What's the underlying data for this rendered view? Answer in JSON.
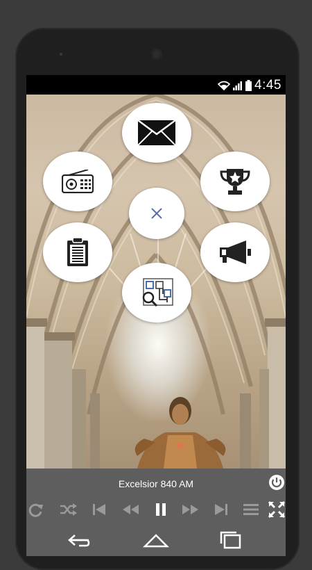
{
  "status": {
    "time": "4:45"
  },
  "player": {
    "station": "Excelsior 840 AM"
  },
  "menu": {
    "items": [
      {
        "id": "email",
        "icon": "envelope-icon"
      },
      {
        "id": "radio",
        "icon": "radio-icon"
      },
      {
        "id": "trophy",
        "icon": "trophy-icon"
      },
      {
        "id": "close",
        "icon": "close-icon"
      },
      {
        "id": "clipboard",
        "icon": "clipboard-icon"
      },
      {
        "id": "announce",
        "icon": "megaphone-icon"
      },
      {
        "id": "search",
        "icon": "search-schedule-icon"
      }
    ]
  },
  "colors": {
    "player_bg": "#5e5e5e",
    "fab_bg": "#ffffff",
    "close_accent": "#5a6fa5"
  }
}
